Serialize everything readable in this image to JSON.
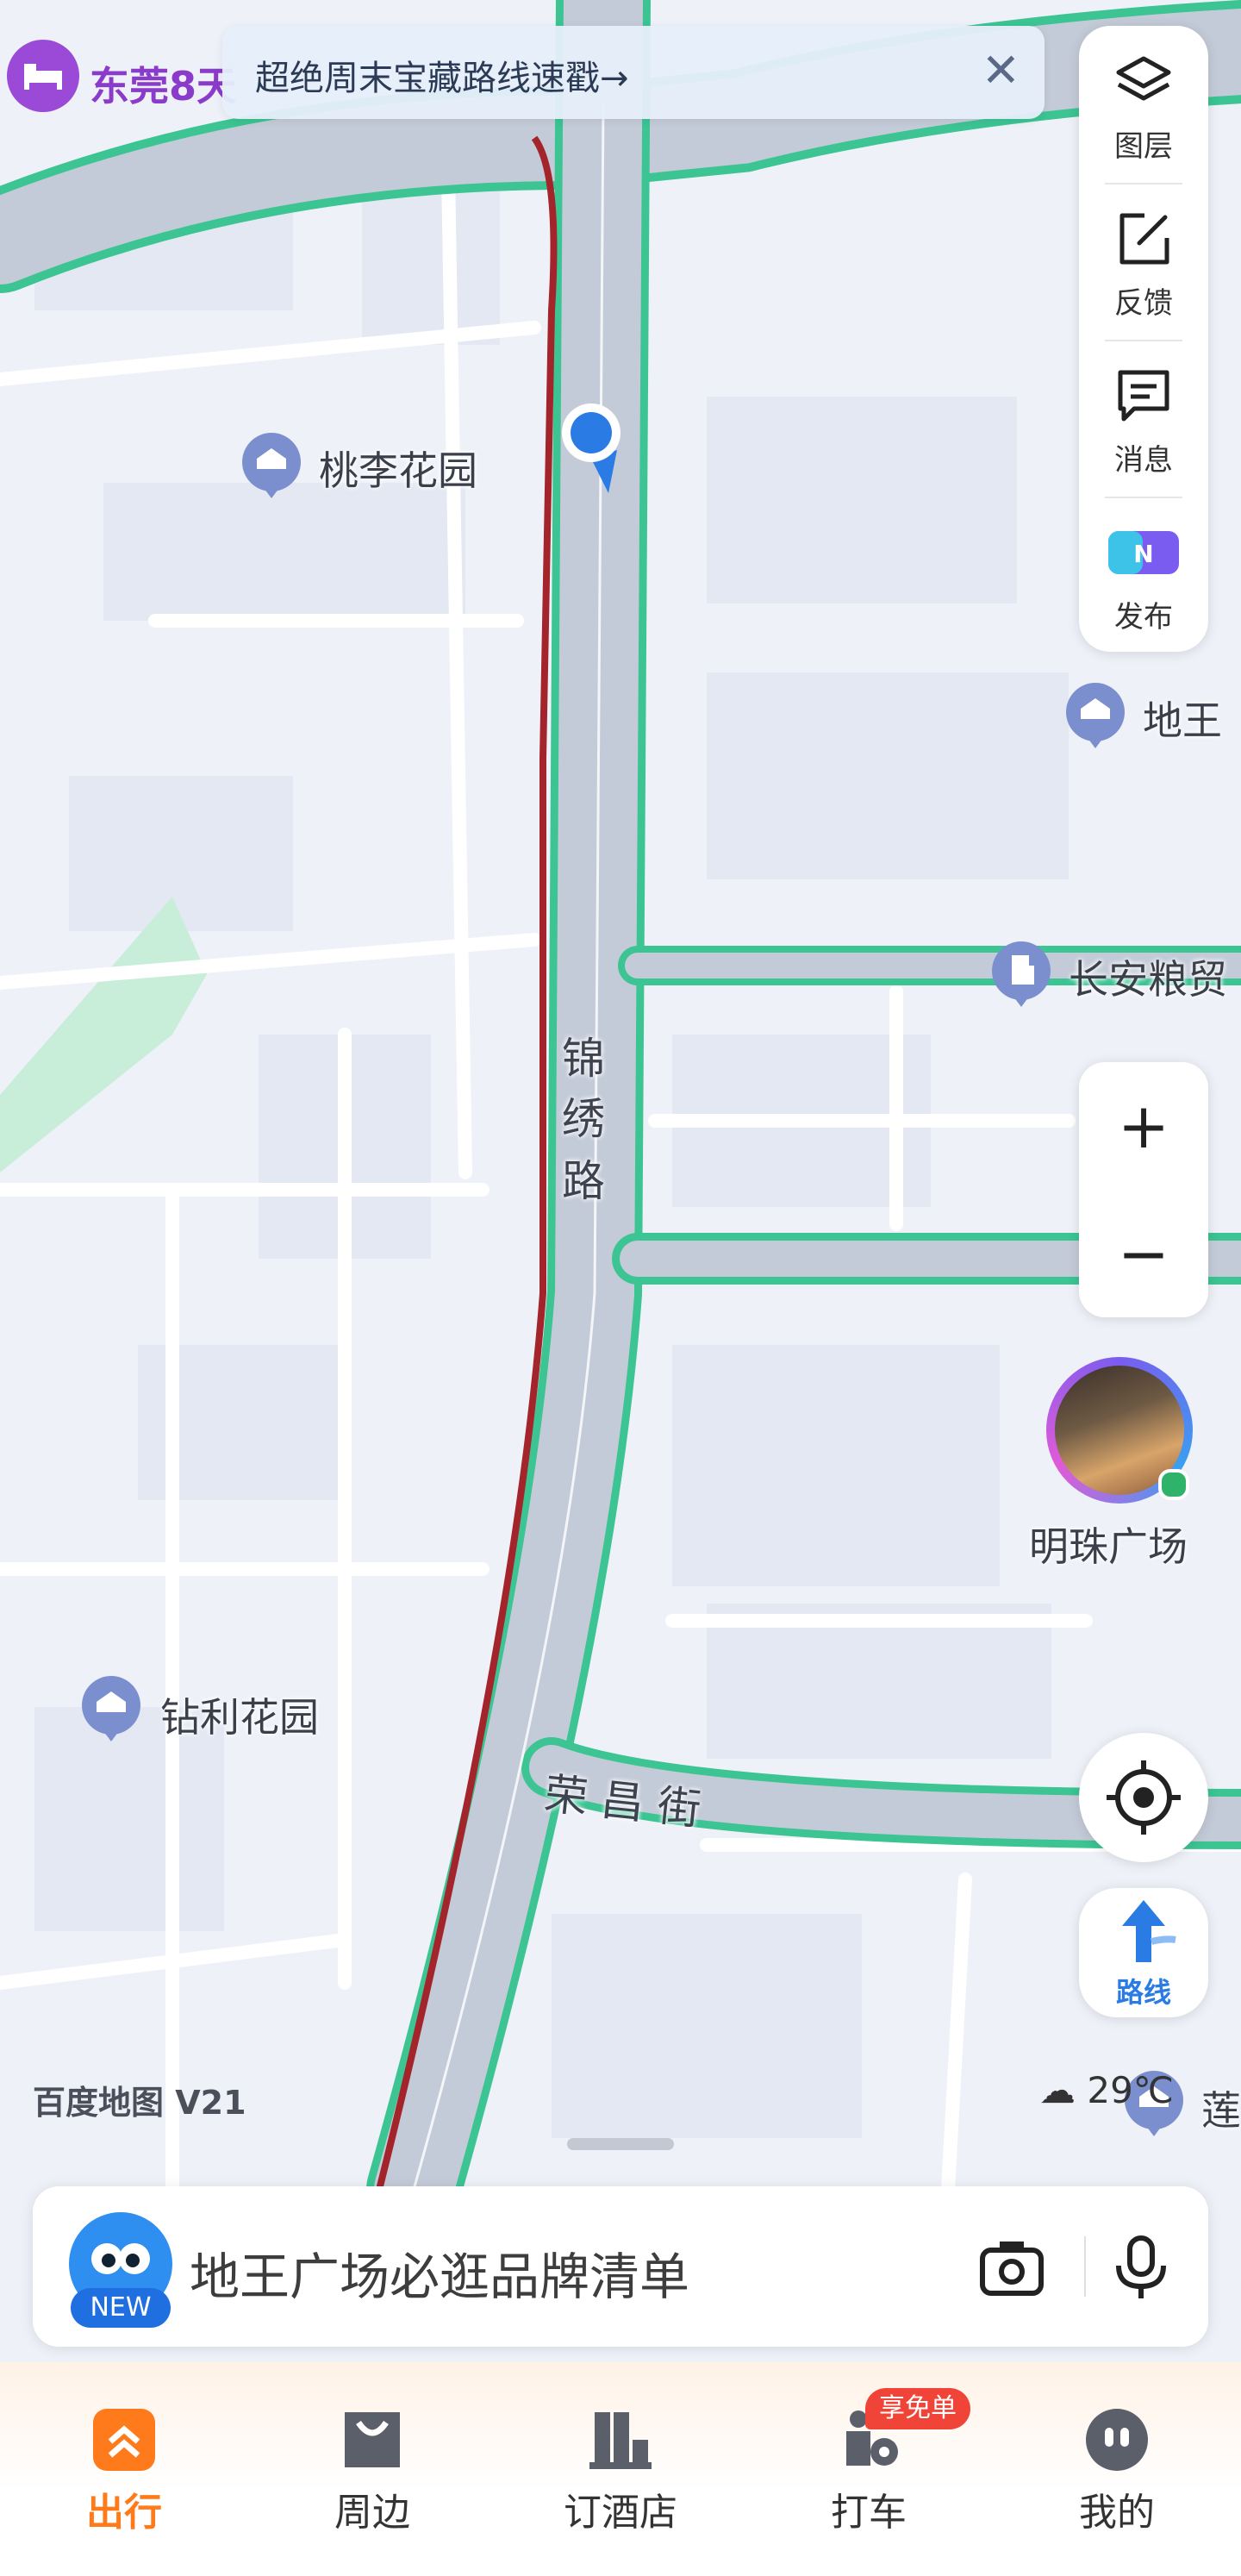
{
  "banner": {
    "hotel_text": "东莞8天",
    "text": "超绝周末宝藏路线速戳→",
    "close": "✕"
  },
  "panel": {
    "layers": "图层",
    "feedback": "反馈",
    "messages": "消息",
    "publish": "发布"
  },
  "map": {
    "pois": {
      "taoli": "桃李花园",
      "diwang": "地王",
      "changan": "长安粮贸",
      "mingzhu": "明珠广场",
      "zuanli": "钻利花园",
      "lian": "莲"
    },
    "roads": {
      "jinxiu_1": "锦",
      "jinxiu_2": "绣",
      "jinxiu_3": "路",
      "rongchang": "荣 昌 街"
    },
    "logo": "百度地图 V21",
    "weather": "29℃"
  },
  "zoom": {
    "plus": "+",
    "minus": "−"
  },
  "route": {
    "label": "路线"
  },
  "search": {
    "badge": "NEW",
    "placeholder": "地王广场必逛品牌清单"
  },
  "tabs": [
    {
      "label": "出行",
      "active": true
    },
    {
      "label": "周边"
    },
    {
      "label": "订酒店"
    },
    {
      "label": "打车",
      "badge": "享免单"
    },
    {
      "label": "我的"
    }
  ],
  "colors": {
    "accent_orange": "#ff7a1a",
    "route_blue": "#2a7be4",
    "road_green": "#3cc493",
    "traffic_red": "#a3242b"
  }
}
